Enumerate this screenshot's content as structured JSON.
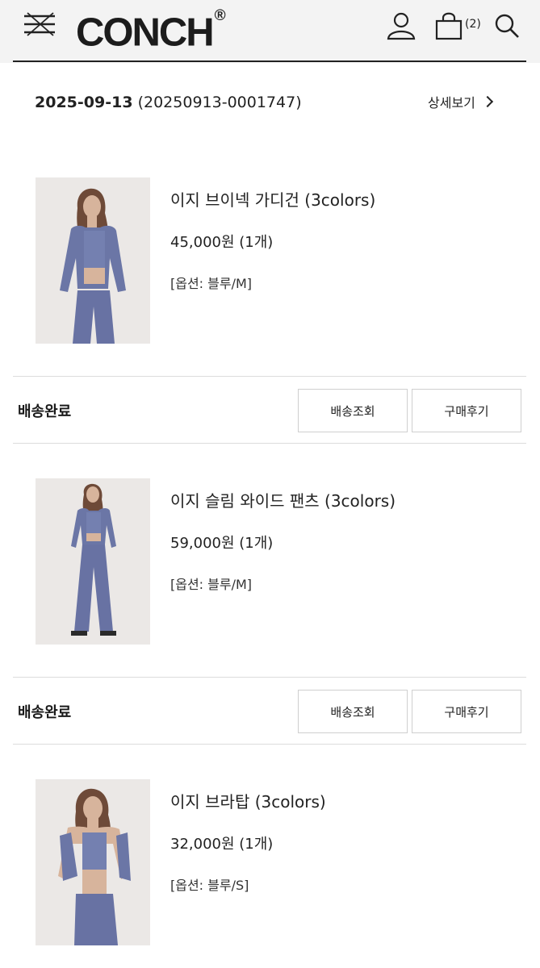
{
  "header": {
    "logo": "CONCH",
    "logo_mark": "®",
    "cart_count": "(2)",
    "icons": [
      "menu-icon",
      "user-icon",
      "shopping-bag-icon",
      "search-icon"
    ]
  },
  "order": {
    "date": "2025-09-13",
    "number": "(20250913-0001747)",
    "detail_label": "상세보기"
  },
  "items": [
    {
      "name": "이지 브이넥 가디건 (3colors)",
      "price": "45,000원 (1개)",
      "option": "[옵션: 블루/M]",
      "status": "배송완료",
      "track_label": "배송조회",
      "review_label": "구매후기"
    },
    {
      "name": "이지 슬림 와이드 팬츠 (3colors)",
      "price": "59,000원 (1개)",
      "option": "[옵션: 블루/M]",
      "status": "배송완료",
      "track_label": "배송조회",
      "review_label": "구매후기"
    },
    {
      "name": "이지 브라탑 (3colors)",
      "price": "32,000원 (1개)",
      "option": "[옵션: 블루/S]"
    }
  ],
  "colors": {
    "header_bg": "#f3f3f3",
    "text": "#222222",
    "divider": "#dcdcdc",
    "garment_blue": "#6b76a6"
  }
}
